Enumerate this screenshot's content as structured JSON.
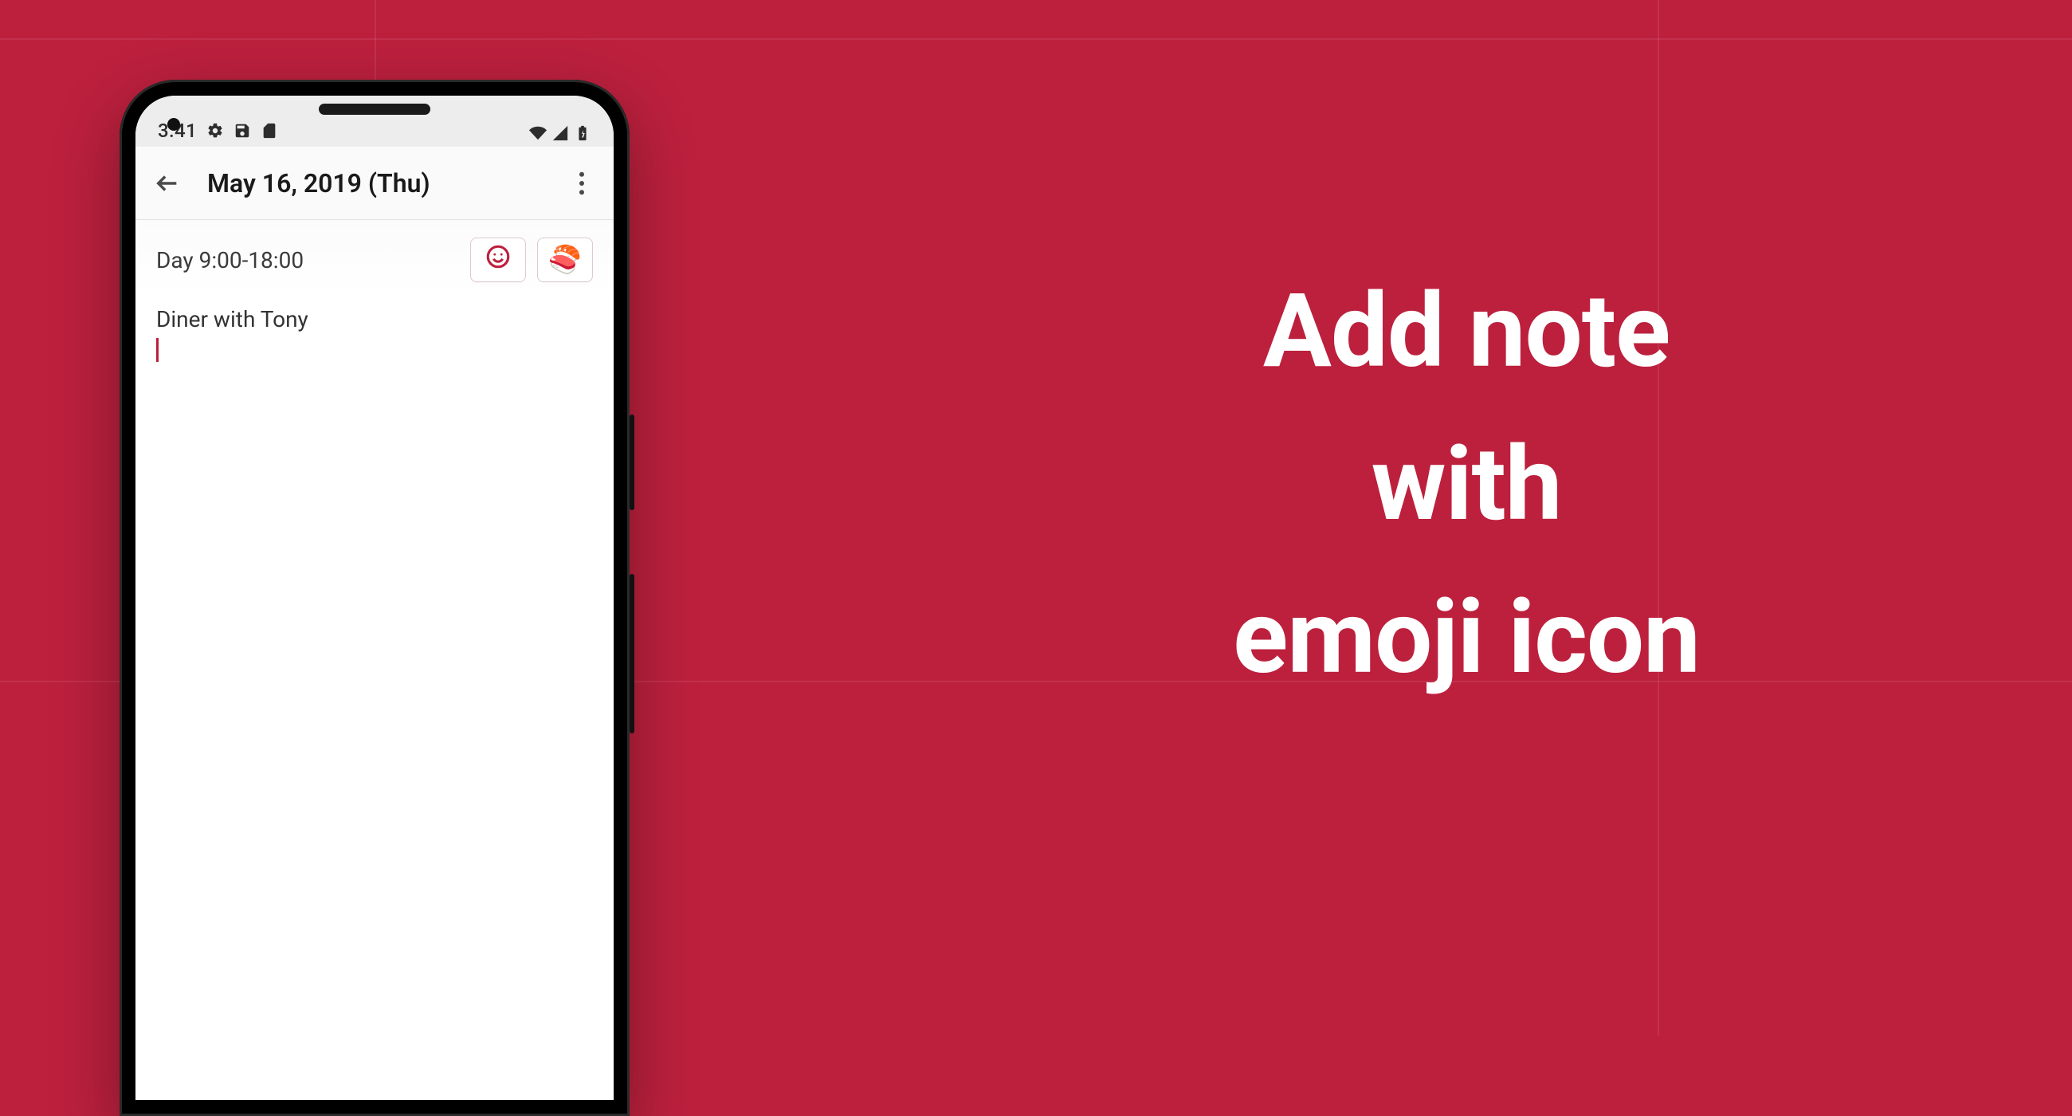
{
  "background_color": "#bc203d",
  "headline": {
    "line1": "Add note",
    "line2": "with",
    "line3": "emoji icon"
  },
  "phone": {
    "statusbar": {
      "time": "3:41",
      "left_icons": [
        "gear-icon",
        "save-icon",
        "sd-card-icon"
      ],
      "right_icons": [
        "wifi-icon",
        "signal-icon",
        "battery-icon"
      ]
    },
    "appbar": {
      "title": "May 16, 2019 (Thu)"
    },
    "shift": {
      "label": "Day 9:00-18:00",
      "emoji_button_icon": "smile-icon",
      "selected_emoji": "🍣"
    },
    "note": {
      "text": "Diner with Tony"
    }
  }
}
